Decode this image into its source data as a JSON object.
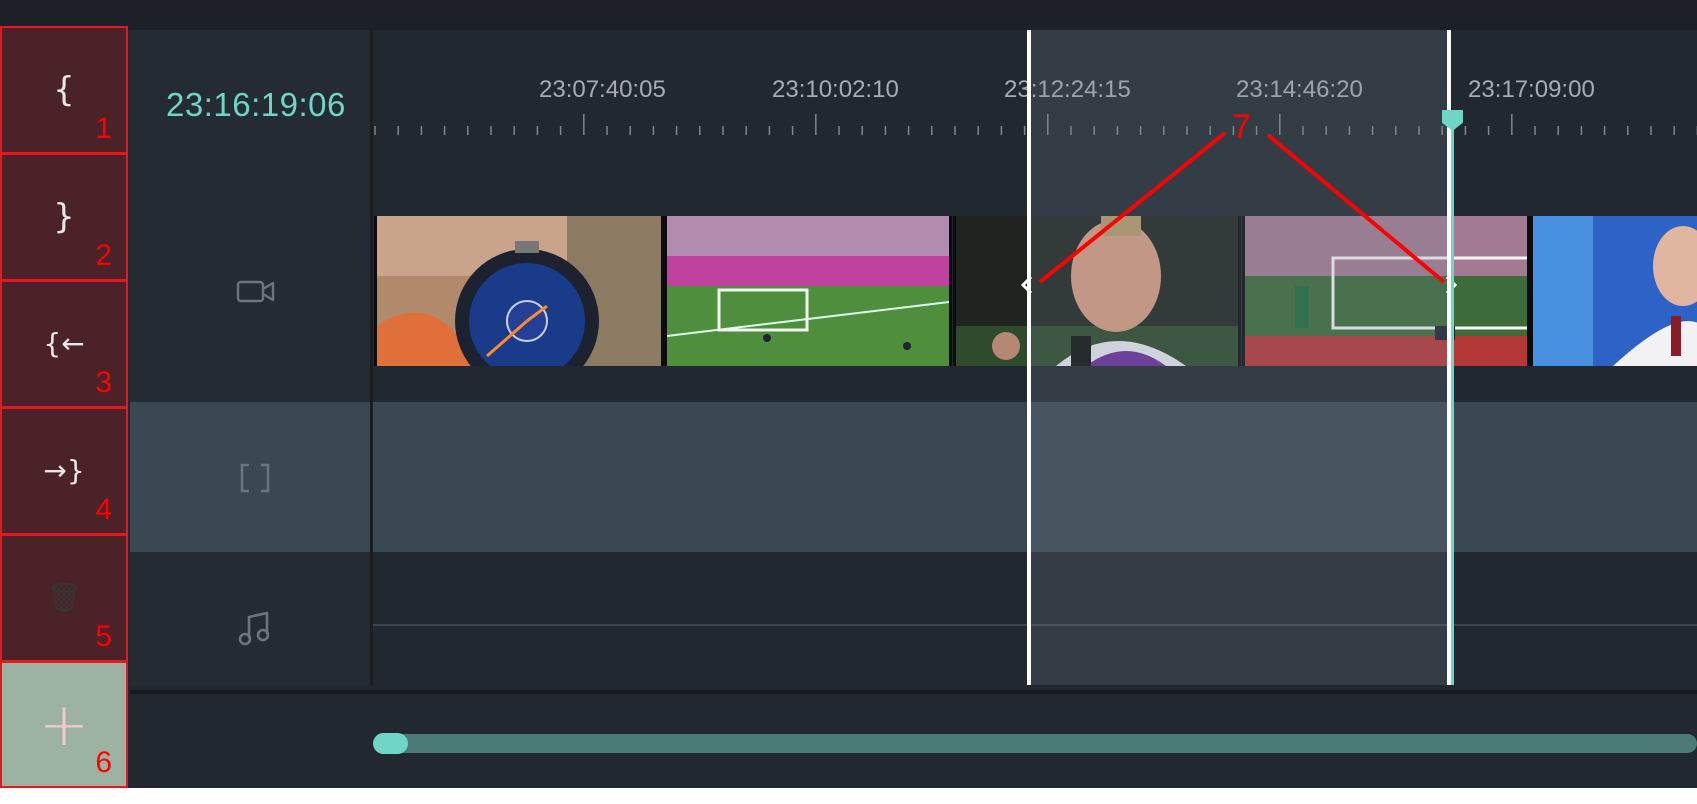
{
  "timeline": {
    "timecode": "23:16:19:06",
    "ruler_labels": [
      "23:07:40:05",
      "23:10:02:10",
      "23:12:24:15",
      "23:14:46:20",
      "23:17:09:00"
    ]
  },
  "toolbar": {
    "buttons": [
      {
        "glyph": "{",
        "annotation": "1",
        "icon": "mark-in-icon"
      },
      {
        "glyph": "}",
        "annotation": "2",
        "icon": "mark-out-icon"
      },
      {
        "glyph": "{←",
        "annotation": "3",
        "icon": "go-to-in-icon"
      },
      {
        "glyph": "→}",
        "annotation": "4",
        "icon": "go-to-out-icon"
      },
      {
        "glyph": "🗑",
        "annotation": "5",
        "icon": "trash-icon"
      },
      {
        "glyph": "+",
        "annotation": "6",
        "icon": "plus-icon"
      }
    ]
  },
  "tracks": {
    "video_icon": "video-camera-icon",
    "overlay_icon": "bracket-icon",
    "audio_icon": "music-note-icon"
  },
  "annotation_selection": "7",
  "colors": {
    "accent": "#6fd6c7",
    "annotation": "#ff0000",
    "button_bg": "#4a2227",
    "background": "#22282f"
  }
}
